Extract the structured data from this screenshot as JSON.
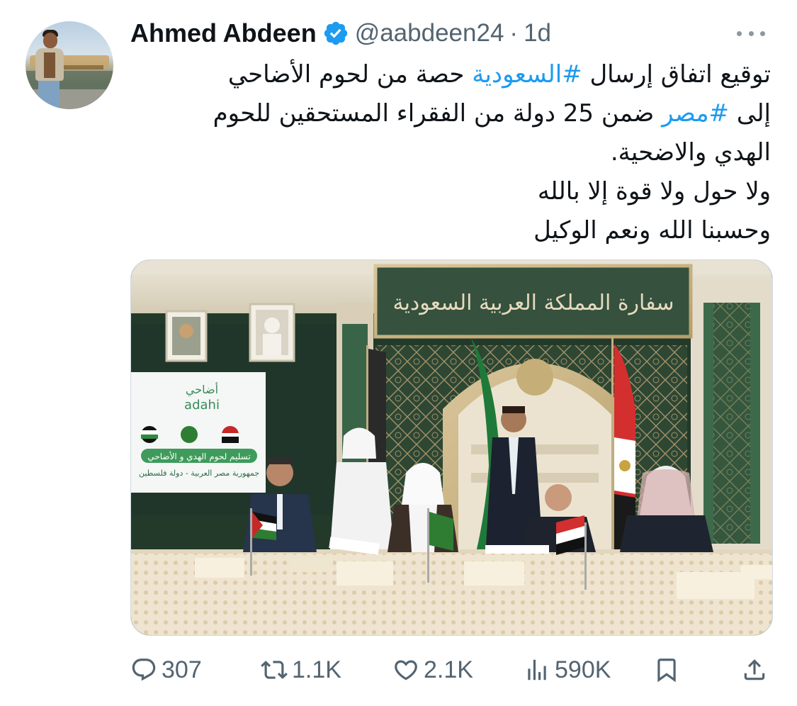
{
  "author": {
    "name": "Ahmed Abdeen",
    "handle": "@aabdeen24",
    "separator": "·",
    "time": "1d",
    "verified": true
  },
  "tweet": {
    "lines": [
      [
        {
          "text": "توقيع اتفاق إرسال ",
          "hashtag": false
        },
        {
          "text": "#السعودية",
          "hashtag": true
        },
        {
          "text": " حصة من لحوم الأضاحي",
          "hashtag": false
        }
      ],
      [
        {
          "text": "إلى ",
          "hashtag": false
        },
        {
          "text": "#مصر",
          "hashtag": true
        },
        {
          "text": " ضمن 25 دولة من الفقراء المستحقين للحوم",
          "hashtag": false
        }
      ],
      [
        {
          "text": "الهدي والاضحية.",
          "hashtag": false
        }
      ],
      [
        {
          "text": "ولا حول ولا قوة إلا بالله",
          "hashtag": false
        }
      ],
      [
        {
          "text": "وحسبنا الله ونعم الوكيل",
          "hashtag": false
        }
      ]
    ]
  },
  "media": {
    "banner_text": "سفارة المملكة العربية السعودية",
    "screen": {
      "brand_arabic": "أضاحي",
      "brand_latin": "adahi",
      "ribbon": "تسليم لحوم الهدي و الأضاحي",
      "caption": "جمهورية مصر العربية - دولة فلسطين"
    }
  },
  "actions": {
    "reply": {
      "count": "307",
      "icon": "reply-icon"
    },
    "retweet": {
      "count": "1.1K",
      "icon": "retweet-icon"
    },
    "like": {
      "count": "2.1K",
      "icon": "heart-icon"
    },
    "views": {
      "count": "590K",
      "icon": "views-icon"
    },
    "bookmark": {
      "icon": "bookmark-icon"
    },
    "share": {
      "icon": "share-icon"
    }
  },
  "colors": {
    "link": "#1d9bf0",
    "secondary_text": "#536471",
    "primary_text": "#0f1419"
  }
}
